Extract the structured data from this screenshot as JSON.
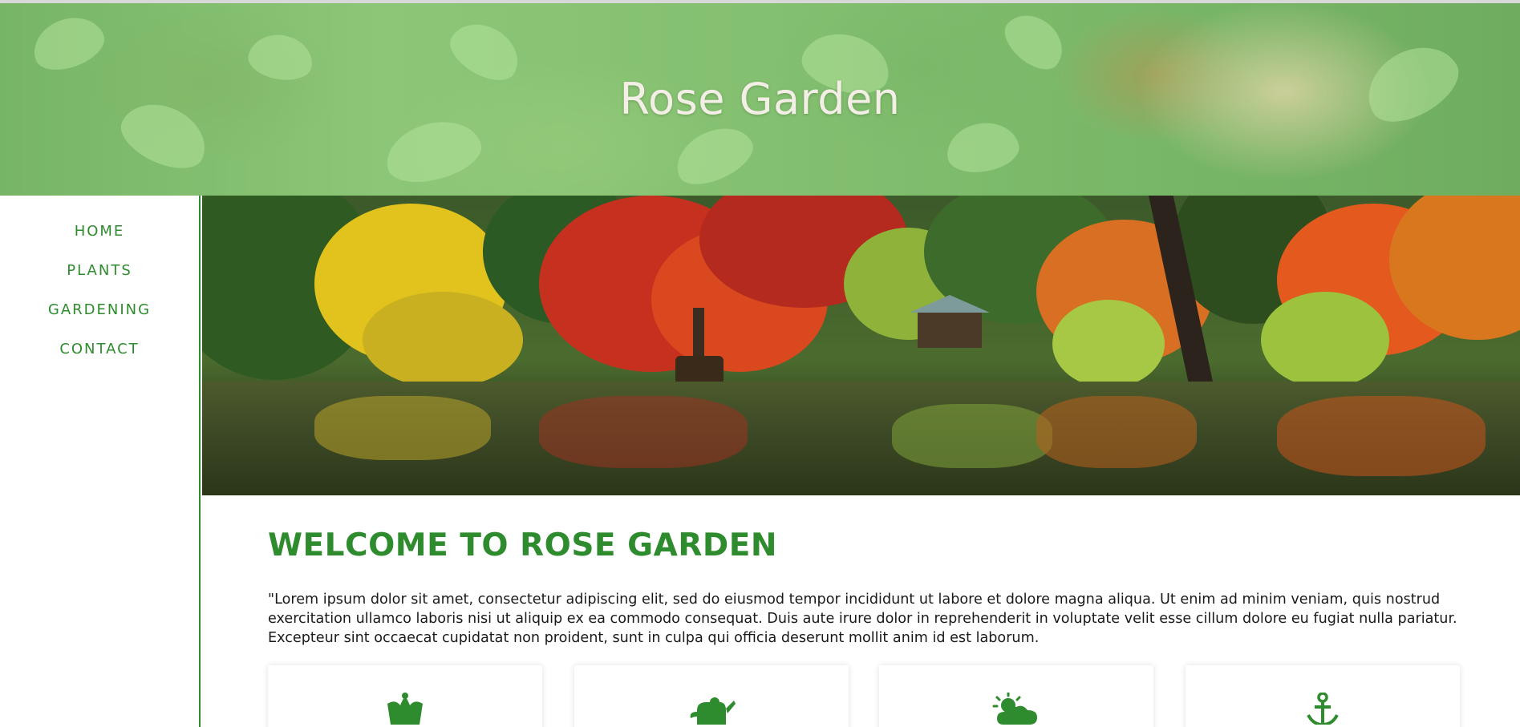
{
  "header": {
    "site_title": "Rose Garden"
  },
  "nav": {
    "items": [
      {
        "label": "HOME"
      },
      {
        "label": "PLANTS"
      },
      {
        "label": "GARDENING"
      },
      {
        "label": "CONTACT"
      }
    ]
  },
  "main": {
    "heading": "WELCOME TO ROSE GARDEN",
    "intro": "\"Lorem ipsum dolor sit amet, consectetur adipiscing elit, sed do eiusmod tempor incididunt ut labore et dolore magna aliqua. Ut enim ad minim veniam, quis nostrud exercitation ullamco laboris nisi ut aliquip ex ea commodo consequat. Duis aute irure dolor in reprehenderit in voluptate velit esse cillum dolore eu fugiat nulla pariatur. Excepteur sint occaecat cupidatat non proident, sunt in culpa qui officia deserunt mollit anim id est laborum.",
    "cards": [
      {
        "icon": "crown-icon"
      },
      {
        "icon": "watering-can-icon"
      },
      {
        "icon": "sun-cloud-icon"
      },
      {
        "icon": "anchor-icon"
      }
    ]
  },
  "colors": {
    "accent": "#2e8b2e",
    "title": "#f4efe6",
    "text": "#1a1a1a"
  }
}
